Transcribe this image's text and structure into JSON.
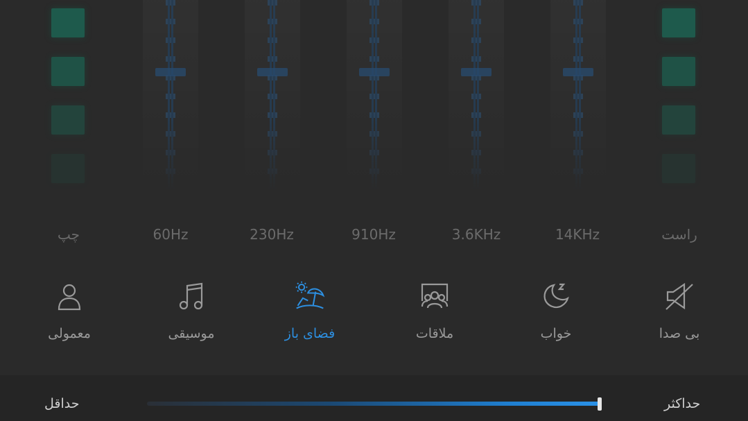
{
  "eq_labels": {
    "left_channel": "چپ",
    "band_1": "60Hz",
    "band_2": "230Hz",
    "band_3": "910Hz",
    "band_4": "3.6KHz",
    "band_5": "14KHz",
    "right_channel": "راست"
  },
  "presets": [
    {
      "label": "معمولی",
      "icon": "person-icon",
      "active": false
    },
    {
      "label": "موسیقی",
      "icon": "music-note-icon",
      "active": false
    },
    {
      "label": "فضای باز",
      "icon": "beach-umbrella-icon",
      "active": true
    },
    {
      "label": "ملاقات",
      "icon": "meeting-group-icon",
      "active": false
    },
    {
      "label": "خواب",
      "icon": "moon-sleep-icon",
      "active": false
    },
    {
      "label": "بی صدا",
      "icon": "mute-speaker-icon",
      "active": false
    }
  ],
  "volume": {
    "min_label": "حداقل",
    "max_label": "حداکثر",
    "level": 1.0
  },
  "colors": {
    "accent": "#2d8fe0",
    "vu_meter": "#1e5a4c",
    "background": "#2a2a2a"
  }
}
